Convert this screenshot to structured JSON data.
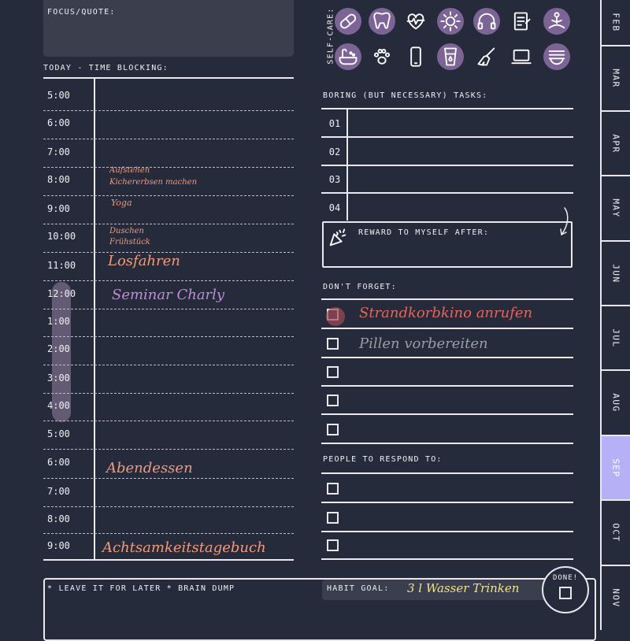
{
  "focus": {
    "label": "FOCUS/QUOTE:"
  },
  "time_blocking": {
    "label": "TODAY - TIME BLOCKING:",
    "times": [
      "5:00",
      "6:00",
      "7:00",
      "8:00",
      "9:00",
      "10:00",
      "11:00",
      "12:00",
      "1:00",
      "2:00",
      "3:00",
      "4:00",
      "5:00",
      "6:00",
      "7:00",
      "8:00",
      "9:00"
    ],
    "entries": [
      {
        "text": "Aufstehen",
        "color": "#f09a7d"
      },
      {
        "text": "Kichererbsen machen",
        "color": "#f09a7d"
      },
      {
        "text": "Yoga",
        "color": "#f09a7d"
      },
      {
        "text": "Duschen",
        "color": "#f09a7d"
      },
      {
        "text": "Frühstück",
        "color": "#f09a7d"
      },
      {
        "text": "Losfahren",
        "color": "#f09a7d"
      },
      {
        "text": "Seminar Charly",
        "color": "#c08ad6"
      },
      {
        "text": "Abendessen",
        "color": "#f09a7d"
      },
      {
        "text": "Achtsamkeitstagebuch",
        "color": "#f09a7d"
      }
    ]
  },
  "self_care": {
    "label": "SELF-CARE:",
    "icons": [
      "pill-icon",
      "tooth-icon",
      "heartbeat-icon",
      "sun-icon",
      "headphones-icon",
      "journal-icon",
      "meditation-icon",
      "bath-icon",
      "paw-icon",
      "phone-icon",
      "water-glass-icon",
      "broom-icon",
      "laptop-icon",
      "bowl-icon"
    ]
  },
  "boring_tasks": {
    "label": "BORING (BUT NECESSARY) TASKS:",
    "numbers": [
      "01",
      "02",
      "03",
      "04"
    ]
  },
  "reward": {
    "label": "REWARD TO MYSELF AFTER:"
  },
  "dont_forget": {
    "label": "DON'T FORGET:",
    "items": [
      {
        "text": "Strandkorbkino anrufen",
        "color": "#e3655f"
      },
      {
        "text": "Pillen vorbereiten",
        "color": "#9a9ca4"
      }
    ]
  },
  "people": {
    "label": "PEOPLE TO RESPOND TO:"
  },
  "brain_dump": {
    "label": "* LEAVE IT FOR LATER * BRAIN DUMP"
  },
  "habit": {
    "label": "HABIT GOAL:",
    "value": "3 l Wasser Trinken",
    "value_color": "#f0e48a"
  },
  "done": {
    "label": "DONE!"
  },
  "months": [
    "FEB",
    "MAR",
    "APR",
    "MAY",
    "JUN",
    "JUL",
    "AUG",
    "SEP",
    "OCT",
    "NOV"
  ],
  "active_month": "SEP",
  "colors": {
    "background": "#262b3b",
    "accent": "#7c6596",
    "active_tab": "#b6b0f6",
    "highlight": "#6e647f"
  }
}
